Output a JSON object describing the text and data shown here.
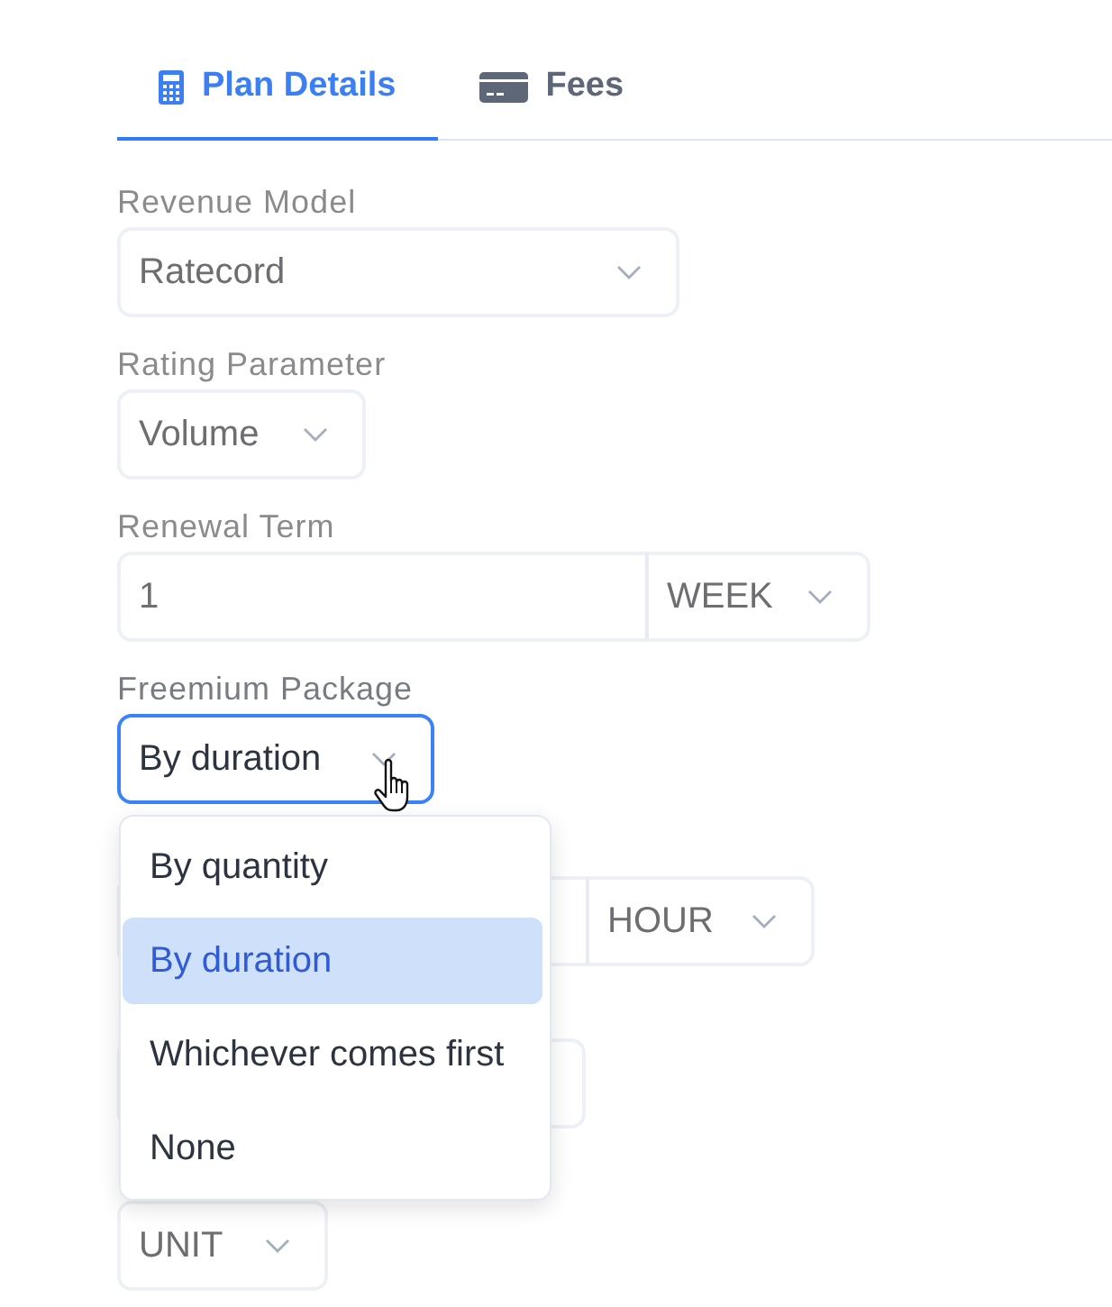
{
  "tabs": [
    {
      "label": "Plan Details",
      "selected": true
    },
    {
      "label": "Fees",
      "selected": false
    }
  ],
  "fields": [
    {
      "kind": "select",
      "label": "Revenue Model",
      "value": "Ratecord",
      "expanded": false
    },
    {
      "kind": "select",
      "label": "Rating Parameter",
      "value": "Volume",
      "expanded": false
    },
    {
      "kind": "input_select",
      "label": "Renewal Term",
      "value": "1",
      "unit": "WEEK",
      "expanded": false
    },
    {
      "kind": "select",
      "label": "Freemium Package",
      "value": "By duration",
      "expanded": true,
      "options": [
        {
          "label": "By quantity",
          "selected": false
        },
        {
          "label": "By duration",
          "selected": true
        },
        {
          "label": "Whichever comes first",
          "selected": false
        },
        {
          "label": "None",
          "selected": false
        }
      ]
    },
    {
      "kind": "input_select",
      "unit": "HOUR",
      "expanded": false
    },
    {
      "kind": "input"
    },
    {
      "kind": "select",
      "value": "UNIT",
      "expanded": false
    }
  ]
}
